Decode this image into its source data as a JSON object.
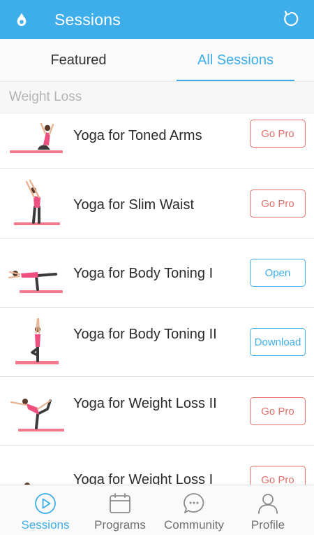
{
  "header": {
    "title": "Sessions",
    "logo_icon": "water-drop-icon",
    "refresh_icon": "refresh-icon",
    "color": "#3daeea"
  },
  "tabs": [
    {
      "label": "Featured",
      "active": false
    },
    {
      "label": "All Sessions",
      "active": true
    }
  ],
  "section": {
    "title": "Weight Loss"
  },
  "sessions": [
    {
      "title": "Yoga for Toned Arms",
      "button": "Go Pro",
      "button_type": "pro"
    },
    {
      "title": "Yoga for Slim Waist",
      "button": "Go Pro",
      "button_type": "pro"
    },
    {
      "title": "Yoga for Body Toning I",
      "button": "Open",
      "button_type": "open"
    },
    {
      "title": "Yoga for Body Toning II",
      "button": "Download",
      "button_type": "open"
    },
    {
      "title": "Yoga for Weight Loss II",
      "button": "Go Pro",
      "button_type": "pro"
    },
    {
      "title": "Yoga for Weight Loss I",
      "button": "Go Pro",
      "button_type": "pro"
    }
  ],
  "bottom_nav": [
    {
      "label": "Sessions",
      "icon": "play-circle-icon",
      "active": true
    },
    {
      "label": "Programs",
      "icon": "calendar-icon",
      "active": false
    },
    {
      "label": "Community",
      "icon": "chat-bubble-icon",
      "active": false
    },
    {
      "label": "Profile",
      "icon": "person-icon",
      "active": false
    }
  ],
  "colors": {
    "accent": "#3daeea",
    "pro": "#e46f6a",
    "mat": "#f27a8c",
    "top": "#ee4f7e",
    "pants": "#3a3a3a"
  }
}
